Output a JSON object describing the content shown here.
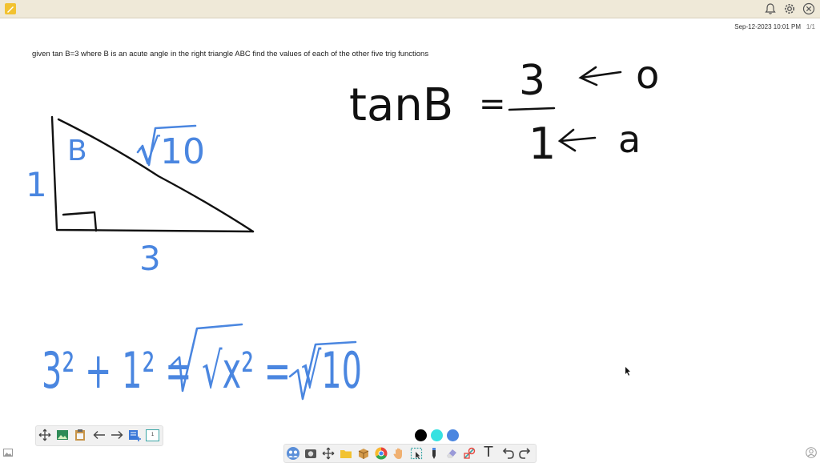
{
  "header": {
    "timestamp": "Sep-12-2023 10:01 PM",
    "page_indicator": "1/1",
    "icons": [
      "pencil-icon",
      "bell-icon",
      "gear-icon",
      "close-icon"
    ]
  },
  "problem": {
    "text": "given tan B=3 where B is an acute angle in the right triangle ABC find the values of each of the other five trig functions"
  },
  "handwriting": {
    "equation_lhs": "tanB",
    "equals": "=",
    "numerator": "3",
    "denominator": "1",
    "arrow": "←",
    "opposite_label": "o",
    "adjacent_label": "a",
    "triangle_angle": "B",
    "triangle_vertical_side": "1",
    "triangle_hypotenuse": "√10",
    "triangle_base": "3",
    "pythagoras": "3² + 1² = √x² = √10"
  },
  "colors": {
    "ink_black": "#111111",
    "ink_blue": "#4a86e0",
    "topbar": "#efe9d8",
    "swatch_black": "#000000",
    "swatch_cyan": "#36e1e1",
    "swatch_blue": "#4a86e0"
  },
  "left_toolbar": {
    "tools": [
      "move-icon",
      "image-icon",
      "clipboard-icon",
      "undo-page-icon",
      "redo-page-icon",
      "add-page-icon",
      "page-thumbnail-icon"
    ],
    "page_number": "1"
  },
  "bottom_toolbar": {
    "tools": [
      "people-icon",
      "camera-icon",
      "pan-icon",
      "folder-icon",
      "box-icon",
      "chrome-icon",
      "hand-icon",
      "select-icon",
      "pen-icon",
      "eraser-icon",
      "shapes-icon",
      "text-icon",
      "undo-icon",
      "redo-icon"
    ],
    "text_tool_glyph": "T"
  }
}
